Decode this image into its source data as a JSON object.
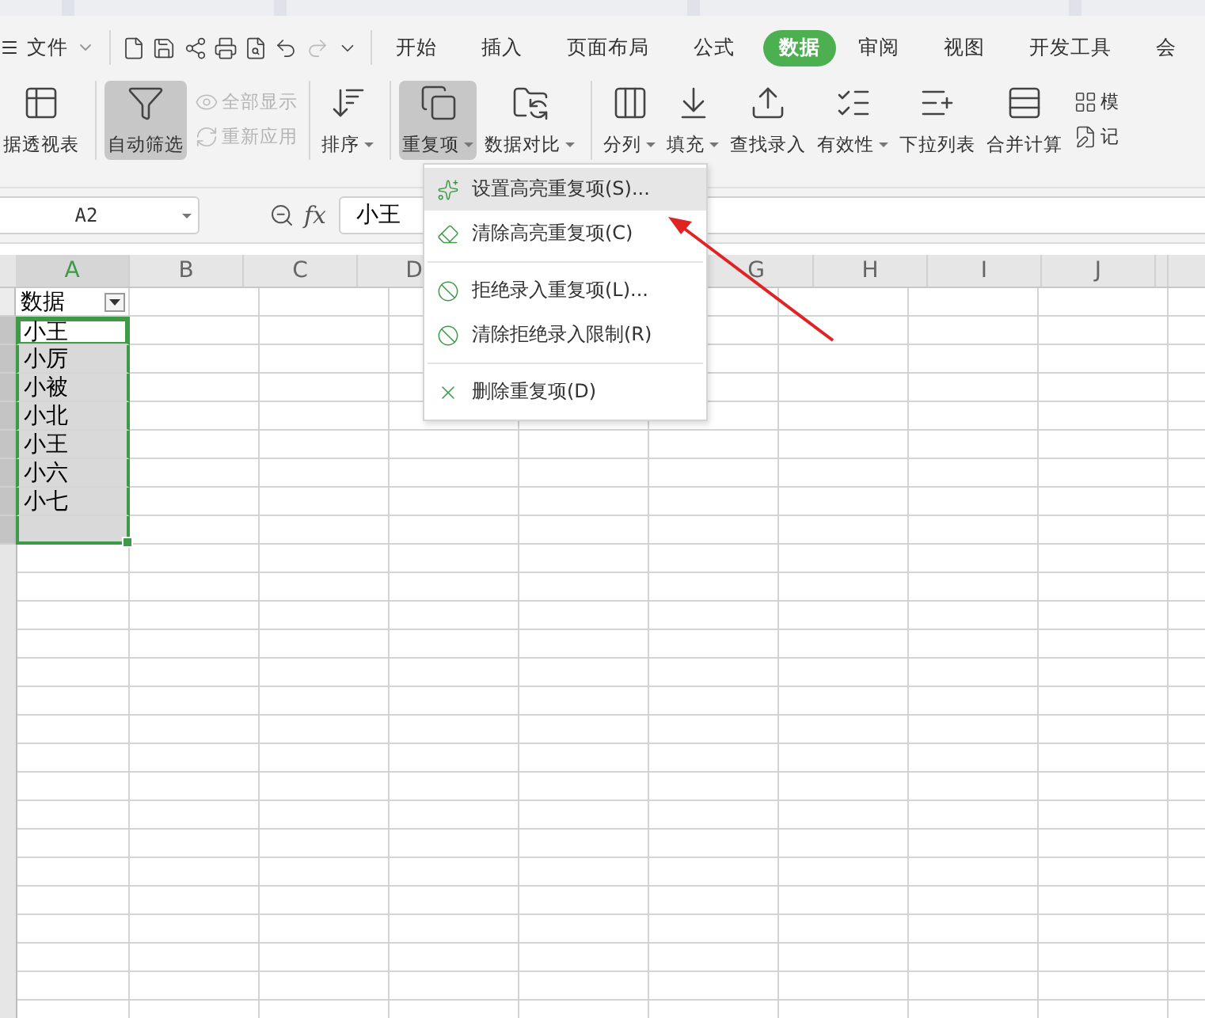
{
  "quick_menu": {
    "label": "文件"
  },
  "menu_tabs": [
    {
      "label": "开始",
      "selected": false
    },
    {
      "label": "插入",
      "selected": false
    },
    {
      "label": "页面布局",
      "selected": false
    },
    {
      "label": "公式",
      "selected": false
    },
    {
      "label": "数据",
      "selected": true
    },
    {
      "label": "审阅",
      "selected": false
    },
    {
      "label": "视图",
      "selected": false
    },
    {
      "label": "开发工具",
      "selected": false
    },
    {
      "label": "会",
      "selected": false
    }
  ],
  "ribbon": [
    {
      "kind": "large",
      "label": "据透视表",
      "pressed": false,
      "dropdown": false
    },
    {
      "kind": "large",
      "label": "自动筛选",
      "pressed": true,
      "dropdown": false
    },
    {
      "kind": "stack",
      "items": [
        {
          "label": "全部显示",
          "disabled": true
        },
        {
          "label": "重新应用",
          "disabled": true
        }
      ]
    },
    {
      "kind": "large",
      "label": "排序",
      "pressed": false,
      "dropdown": true
    },
    {
      "kind": "large",
      "label": "重复项",
      "pressed": true,
      "dropdown": true
    },
    {
      "kind": "large",
      "label": "数据对比",
      "pressed": false,
      "dropdown": true
    },
    {
      "kind": "large",
      "label": "分列",
      "pressed": false,
      "dropdown": true
    },
    {
      "kind": "large",
      "label": "填充",
      "pressed": false,
      "dropdown": true
    },
    {
      "kind": "large",
      "label": "查找录入",
      "pressed": false,
      "dropdown": false
    },
    {
      "kind": "large",
      "label": "有效性",
      "pressed": false,
      "dropdown": true
    },
    {
      "kind": "large",
      "label": "下拉列表",
      "pressed": false,
      "dropdown": false
    },
    {
      "kind": "large",
      "label": "合并计算",
      "pressed": false,
      "dropdown": false
    },
    {
      "kind": "stack",
      "items": [
        {
          "label": "模",
          "disabled": false
        },
        {
          "label": "记",
          "disabled": false
        }
      ]
    }
  ],
  "name_box": "A2",
  "function_label": "fx",
  "formula": "小王",
  "columns_left": [
    {
      "label": "A",
      "selected": true
    },
    {
      "label": "B",
      "selected": false
    },
    {
      "label": "C",
      "selected": false
    },
    {
      "label": "D",
      "selected": false
    }
  ],
  "columns_right": [
    {
      "label": "G",
      "selected": false
    },
    {
      "label": "H",
      "selected": false
    },
    {
      "label": "I",
      "selected": false
    },
    {
      "label": "J",
      "selected": false
    }
  ],
  "rows": [
    {
      "kind": "filter-header",
      "value": "数据",
      "selected": false,
      "active": false
    },
    {
      "kind": "text",
      "value": "小王",
      "selected": true,
      "active": true
    },
    {
      "kind": "text",
      "value": "小厉",
      "selected": true,
      "active": false
    },
    {
      "kind": "text",
      "value": "小被",
      "selected": true,
      "active": false
    },
    {
      "kind": "text",
      "value": "小北",
      "selected": true,
      "active": false
    },
    {
      "kind": "text",
      "value": "小王",
      "selected": true,
      "active": false
    },
    {
      "kind": "text",
      "value": "小六",
      "selected": true,
      "active": false
    },
    {
      "kind": "text",
      "value": "小七",
      "selected": true,
      "active": false
    },
    {
      "kind": "empty",
      "selected": true,
      "active": false
    }
  ],
  "dropdown_menu": [
    [
      {
        "label": "设置高亮重复项(S)...",
        "highlighted": true
      },
      {
        "label": "清除高亮重复项(C)",
        "highlighted": false
      }
    ],
    [
      {
        "label": "拒绝录入重复项(L)...",
        "highlighted": false
      },
      {
        "label": "清除拒绝录入限制(R)",
        "highlighted": false
      }
    ],
    [
      {
        "label": "删除重复项(D)",
        "highlighted": false
      }
    ]
  ]
}
